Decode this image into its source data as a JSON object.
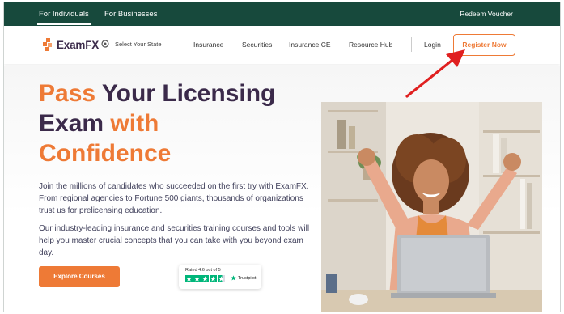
{
  "topbar": {
    "tab_individuals": "For Individuals",
    "tab_businesses": "For Businesses",
    "redeem": "Redeem Voucher"
  },
  "nav": {
    "logo_exam": "Exam",
    "logo_fx": "FX",
    "state_selector": "Select Your State",
    "links": [
      "Insurance",
      "Securities",
      "Insurance CE",
      "Resource Hub"
    ],
    "login": "Login",
    "register": "Register Now"
  },
  "hero": {
    "headline_1a": "Pass",
    "headline_1b": " Your Licensing",
    "headline_2a": "Exam",
    "headline_2b": " with",
    "headline_3": "Confidence",
    "paragraph_1": "Join the millions of candidates who succeeded on the first try with ExamFX. From regional agencies to Fortune 500 giants, thousands of organizations trust us for prelicensing education.",
    "paragraph_2": "Our industry-leading insurance and securities training courses and tools will help you master crucial concepts that you can take with you beyond exam day.",
    "cta": "Explore Courses",
    "trustpilot_rating": "Rated 4.6 out of 5",
    "trustpilot_brand": "Trustpilot",
    "trustpilot_stars": 4.6
  },
  "colors": {
    "brand_dark": "#17493c",
    "accent_orange": "#ee7a36",
    "heading_purple": "#3b2a4a",
    "arrow_red": "#e02020",
    "trustpilot_green": "#00b67a"
  },
  "icons": [
    "location-pin-icon",
    "trustpilot-star-icon",
    "annotation-arrow-icon"
  ]
}
